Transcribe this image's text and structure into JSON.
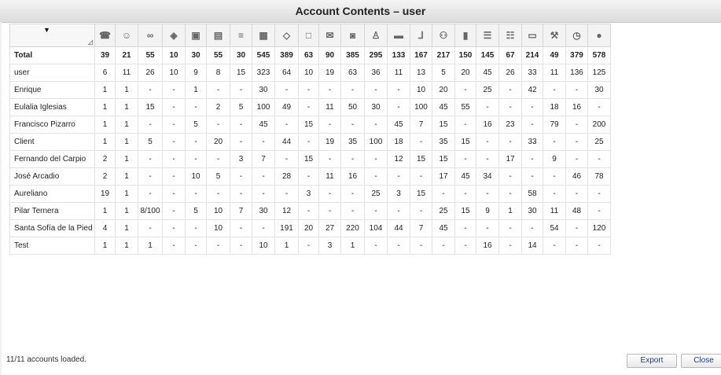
{
  "window": {
    "title": "Account Contents – user"
  },
  "table": {
    "sort_indicator": "▼",
    "resize_indicator": "◿",
    "column_icons": [
      "phone-icon",
      "person-icon",
      "link-icon",
      "tag-icon",
      "image-icon",
      "contact-card-icon",
      "document-icon",
      "calendar-grid-icon",
      "note-icon",
      "date-icon",
      "mail-icon",
      "stamp-icon",
      "person-alt-icon",
      "car-icon",
      "chair-icon",
      "group-icon",
      "vehicle-icon",
      "list-icon",
      "checklist-icon",
      "folder-icon",
      "tools-icon",
      "clock-icon",
      "chat-icon"
    ],
    "rows": [
      {
        "name": "Total",
        "total": true,
        "cells": [
          "39",
          "21",
          "55",
          "10",
          "30",
          "55",
          "30",
          "545",
          "389",
          "63",
          "90",
          "385",
          "295",
          "133",
          "167",
          "217",
          "150",
          "145",
          "67",
          "214",
          "49",
          "379",
          "578"
        ]
      },
      {
        "name": "user",
        "cells": [
          "6",
          "11",
          "26",
          "10",
          "9",
          "8",
          "15",
          "323",
          "64",
          "10",
          "19",
          "63",
          "36",
          "11",
          "13",
          "5",
          "20",
          "45",
          "26",
          "33",
          "11",
          "136",
          "125"
        ]
      },
      {
        "name": "Enrique",
        "cells": [
          "1",
          "1",
          "-",
          "-",
          "1",
          "-",
          "-",
          "30",
          "-",
          "-",
          "-",
          "-",
          "-",
          "-",
          "10",
          "20",
          "-",
          "25",
          "-",
          "42",
          "-",
          "-",
          "30"
        ]
      },
      {
        "name": "Eulalia Iglesias",
        "cells": [
          "1",
          "1",
          "15",
          "-",
          "-",
          "2",
          "5",
          "100",
          "49",
          "-",
          "11",
          "50",
          "30",
          "-",
          "100",
          "45",
          "55",
          "-",
          "-",
          "-",
          "18",
          "16",
          "-"
        ]
      },
      {
        "name": "Francisco Pizarro",
        "cells": [
          "1",
          "1",
          "-",
          "-",
          "5",
          "-",
          "-",
          "45",
          "-",
          "15",
          "-",
          "-",
          "-",
          "45",
          "7",
          "15",
          "-",
          "16",
          "23",
          "-",
          "79",
          "-",
          "200"
        ]
      },
      {
        "name": "Client",
        "cells": [
          "1",
          "1",
          "5",
          "-",
          "-",
          "20",
          "-",
          "-",
          "44",
          "-",
          "19",
          "35",
          "100",
          "18",
          "-",
          "35",
          "15",
          "-",
          "-",
          "33",
          "-",
          "-",
          "25"
        ]
      },
      {
        "name": "Fernando del Carpio",
        "cells": [
          "2",
          "1",
          "-",
          "-",
          "-",
          "-",
          "3",
          "7",
          "-",
          "15",
          "-",
          "-",
          "-",
          "12",
          "15",
          "15",
          "-",
          "-",
          "17",
          "-",
          "9",
          "-",
          "-"
        ]
      },
      {
        "name": "José Arcadio",
        "cells": [
          "2",
          "1",
          "-",
          "-",
          "10",
          "5",
          "-",
          "-",
          "28",
          "-",
          "11",
          "16",
          "-",
          "-",
          "-",
          "17",
          "45",
          "34",
          "-",
          "-",
          "-",
          "46",
          "78"
        ]
      },
      {
        "name": "Aureliano",
        "cells": [
          "19",
          "1",
          "-",
          "-",
          "-",
          "-",
          "-",
          "-",
          "-",
          "3",
          "-",
          "-",
          "25",
          "3",
          "15",
          "-",
          "-",
          "-",
          "-",
          "58",
          "-",
          "-",
          "-"
        ]
      },
      {
        "name": "Pilar Ternera",
        "cells": [
          "1",
          "1",
          "8/100",
          "-",
          "5",
          "10",
          "7",
          "30",
          "12",
          "-",
          "-",
          "-",
          "-",
          "-",
          "-",
          "25",
          "15",
          "9",
          "1",
          "30",
          "11",
          "48",
          "-"
        ]
      },
      {
        "name": "Santa Sofía de la Pied",
        "cells": [
          "4",
          "1",
          "-",
          "-",
          "-",
          "10",
          "-",
          "-",
          "191",
          "20",
          "27",
          "220",
          "104",
          "44",
          "7",
          "45",
          "-",
          "-",
          "-",
          "-",
          "54",
          "-",
          "120"
        ]
      },
      {
        "name": "Test",
        "cells": [
          "1",
          "1",
          "1",
          "-",
          "-",
          "-",
          "-",
          "10",
          "1",
          "-",
          "3",
          "1",
          "-",
          "-",
          "-",
          "-",
          "-",
          "16",
          "-",
          "14",
          "-",
          "-",
          "-"
        ]
      }
    ]
  },
  "status": {
    "text": "11/11 accounts loaded."
  },
  "buttons": {
    "export": "Export",
    "close": "Close"
  }
}
